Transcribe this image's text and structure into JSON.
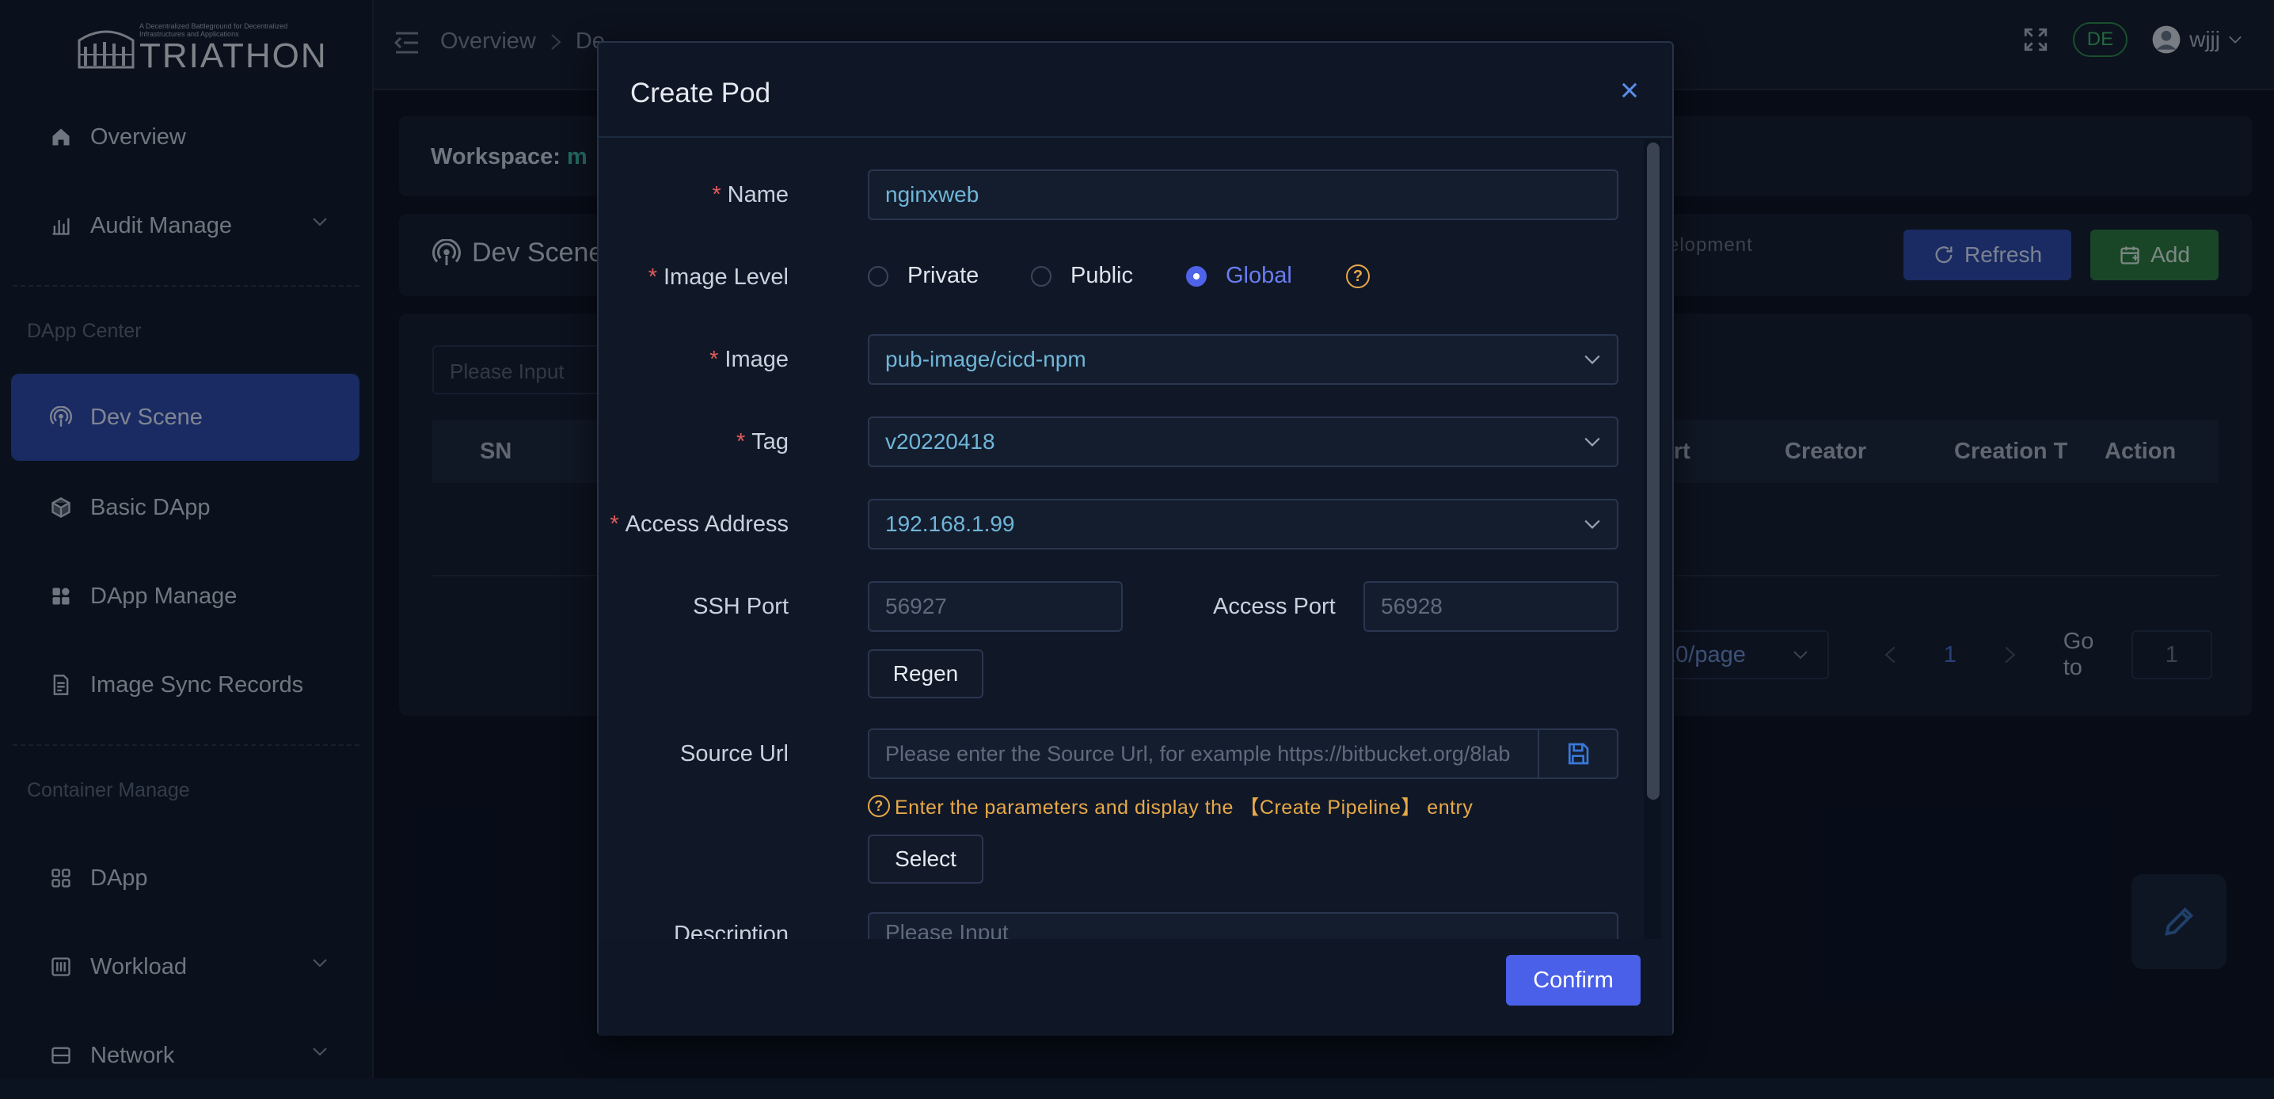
{
  "brand": {
    "tagline": "A Decentralized Battleground for Decentralized Infrastructures and Applications",
    "name": "TRIATHON"
  },
  "sidebar": {
    "items": [
      {
        "label": "Overview",
        "icon": "home-icon"
      },
      {
        "label": "Audit Manage",
        "icon": "bar-chart-icon"
      },
      {
        "label": "Dev Scene",
        "icon": "broadcast-icon"
      },
      {
        "label": "Basic DApp",
        "icon": "cube-icon"
      },
      {
        "label": "DApp Manage",
        "icon": "grid-icon"
      },
      {
        "label": "Image Sync Records",
        "icon": "document-icon"
      },
      {
        "label": "DApp",
        "icon": "apps-icon"
      },
      {
        "label": "Workload",
        "icon": "sliders-icon"
      },
      {
        "label": "Network",
        "icon": "server-icon"
      }
    ],
    "groups": {
      "dapp_center": "DApp Center",
      "container_manage": "Container Manage"
    }
  },
  "topbar": {
    "breadcrumb": [
      "Overview",
      "De..."
    ],
    "lang": "DE",
    "user": "wjjj"
  },
  "page": {
    "workspace_label": "Workspace:",
    "workspace_value": "m",
    "scene_title": "Dev Scene",
    "dev_note": "velopment",
    "refresh": "Refresh",
    "add": "Add",
    "search_placeholder": "Please Input",
    "columns": [
      "SN",
      "ort",
      "Creator",
      "Creation T",
      "Action"
    ],
    "page_size": "10/page",
    "page_current": "1",
    "goto_label": "Go to",
    "goto_value": "1"
  },
  "modal": {
    "title": "Create Pod",
    "fields": {
      "name_label": "Name",
      "name_value": "nginxweb",
      "image_level_label": "Image Level",
      "image_level_options": [
        "Private",
        "Public",
        "Global"
      ],
      "image_level_selected": "Global",
      "image_label": "Image",
      "image_value": "pub-image/cicd-npm",
      "tag_label": "Tag",
      "tag_value": "v20220418",
      "access_address_label": "Access Address",
      "access_address_value": "192.168.1.99",
      "ssh_port_label": "SSH Port",
      "ssh_port_value": "56927",
      "access_port_label": "Access Port",
      "access_port_value": "56928",
      "regen": "Regen",
      "source_url_label": "Source Url",
      "source_url_placeholder": "Please enter the Source Url, for example https://bitbucket.org/8lab",
      "source_url_hint": "Enter the parameters and display the 【Create Pipeline】 entry",
      "select": "Select",
      "description_label": "Description",
      "description_placeholder": "Please Input"
    },
    "confirm": "Confirm"
  },
  "colors": {
    "primary": "#4a60e8",
    "success": "#2f7a3e",
    "warning": "#e8a948",
    "required": "#e45a5a",
    "active_nav": "#2c4aa8"
  }
}
